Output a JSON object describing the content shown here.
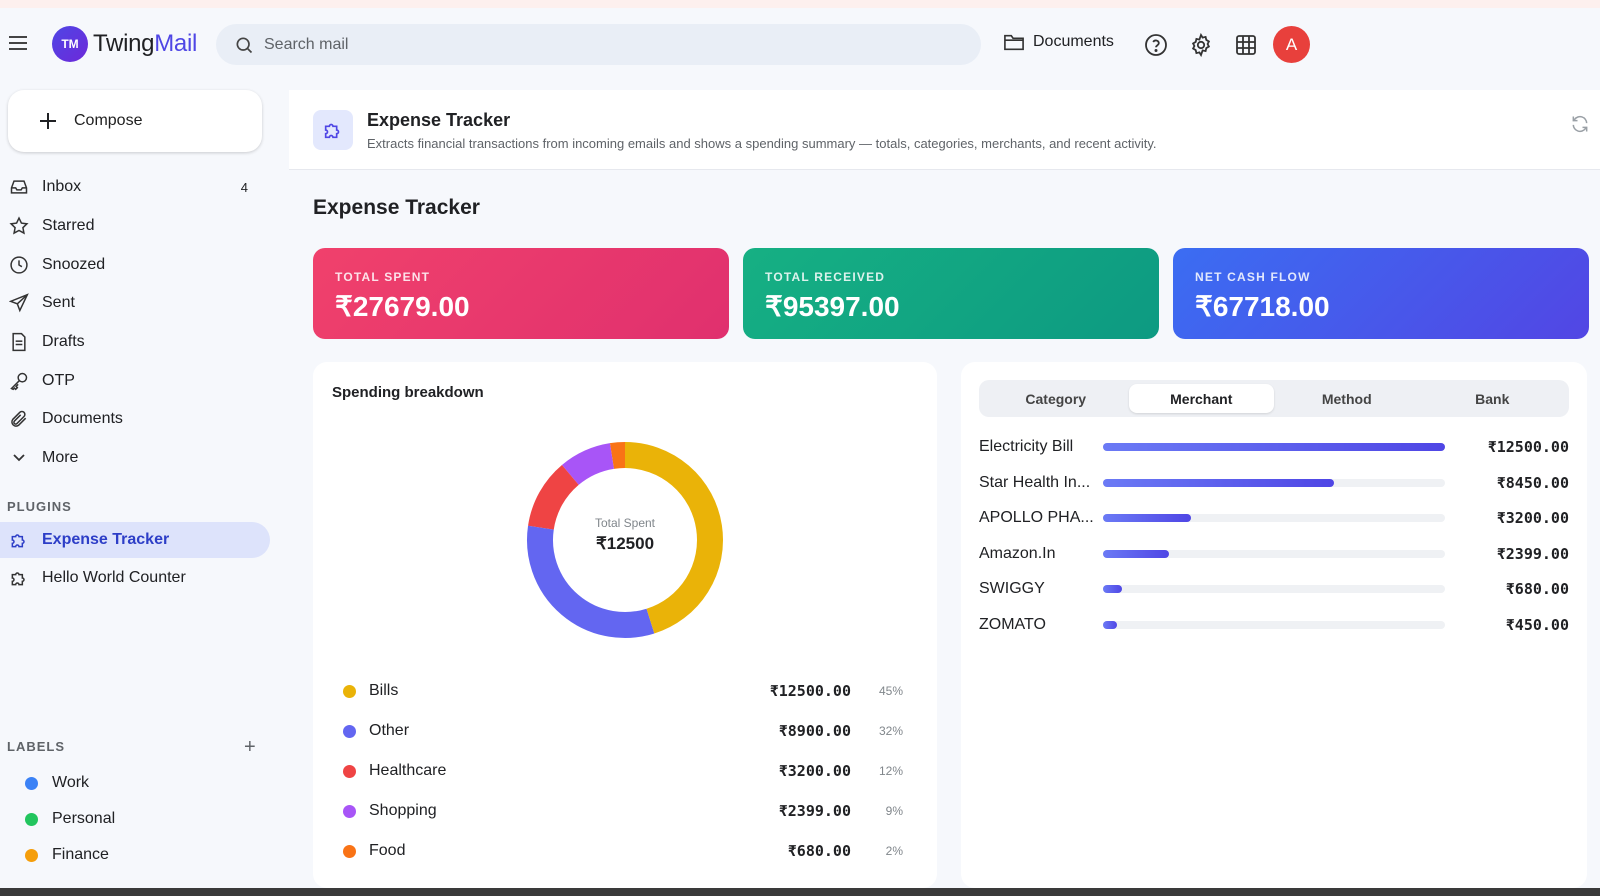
{
  "app": {
    "logo_initials": "TM",
    "name_part1": "Twing",
    "name_part2": "Mail"
  },
  "header": {
    "search_placeholder": "Search mail",
    "documents_label": "Documents",
    "avatar_initial": "A"
  },
  "sidebar": {
    "compose_label": "Compose",
    "items": [
      {
        "label": "Inbox",
        "count": "4",
        "icon": "inbox-icon"
      },
      {
        "label": "Starred",
        "count": "",
        "icon": "star-icon"
      },
      {
        "label": "Snoozed",
        "count": "",
        "icon": "clock-icon"
      },
      {
        "label": "Sent",
        "count": "",
        "icon": "send-icon"
      },
      {
        "label": "Drafts",
        "count": "",
        "icon": "draft-icon"
      },
      {
        "label": "OTP",
        "count": "",
        "icon": "key-icon"
      },
      {
        "label": "Documents",
        "count": "",
        "icon": "paperclip-icon"
      },
      {
        "label": "More",
        "count": "",
        "icon": "chevron-down-icon"
      }
    ],
    "plugins_title": "PLUGINS",
    "plugins": [
      {
        "label": "Expense Tracker",
        "active": true
      },
      {
        "label": "Hello World Counter",
        "active": false
      }
    ],
    "labels_title": "LABELS",
    "labels": [
      {
        "label": "Work",
        "color": "#3b82f6"
      },
      {
        "label": "Personal",
        "color": "#22c55e"
      },
      {
        "label": "Finance",
        "color": "#f59e0b"
      }
    ]
  },
  "plugin": {
    "title": "Expense Tracker",
    "description": "Extracts financial transactions from incoming emails and shows a spending summary — totals, categories, merchants, and recent activity."
  },
  "main": {
    "title": "Expense Tracker",
    "stats": [
      {
        "label": "TOTAL SPENT",
        "value": "₹27679.00"
      },
      {
        "label": "TOTAL RECEIVED",
        "value": "₹95397.00"
      },
      {
        "label": "NET CASH FLOW",
        "value": "₹67718.00"
      }
    ],
    "breakdown_title": "Spending breakdown",
    "donut_center_label": "Total Spent",
    "donut_center_value": "₹12500"
  },
  "chart_data": {
    "type": "pie",
    "categories": [
      "Bills",
      "Other",
      "Healthcare",
      "Shopping",
      "Food"
    ],
    "values": [
      12500,
      8900,
      3200,
      2399,
      680
    ],
    "amount_labels": [
      "₹12500.00",
      "₹8900.00",
      "₹3200.00",
      "₹2399.00",
      "₹680.00"
    ],
    "percent_labels": [
      "45%",
      "32%",
      "12%",
      "9%",
      "2%"
    ],
    "colors": [
      "#eab308",
      "#6366f1",
      "#ef4444",
      "#a855f7",
      "#f97316"
    ]
  },
  "merchants": {
    "tabs": [
      "Category",
      "Merchant",
      "Method",
      "Bank"
    ],
    "active_tab": "Merchant",
    "items": [
      {
        "name": "Electricity Bill",
        "amount": "₹12500.00",
        "value": 12500
      },
      {
        "name": "Star Health In...",
        "amount": "₹8450.00",
        "value": 8450
      },
      {
        "name": "APOLLO PHA...",
        "amount": "₹3200.00",
        "value": 3200
      },
      {
        "name": "Amazon.In",
        "amount": "₹2399.00",
        "value": 2399
      },
      {
        "name": "SWIGGY",
        "amount": "₹680.00",
        "value": 680
      },
      {
        "name": "ZOMATO",
        "amount": "₹450.00",
        "value": 450
      }
    ]
  }
}
